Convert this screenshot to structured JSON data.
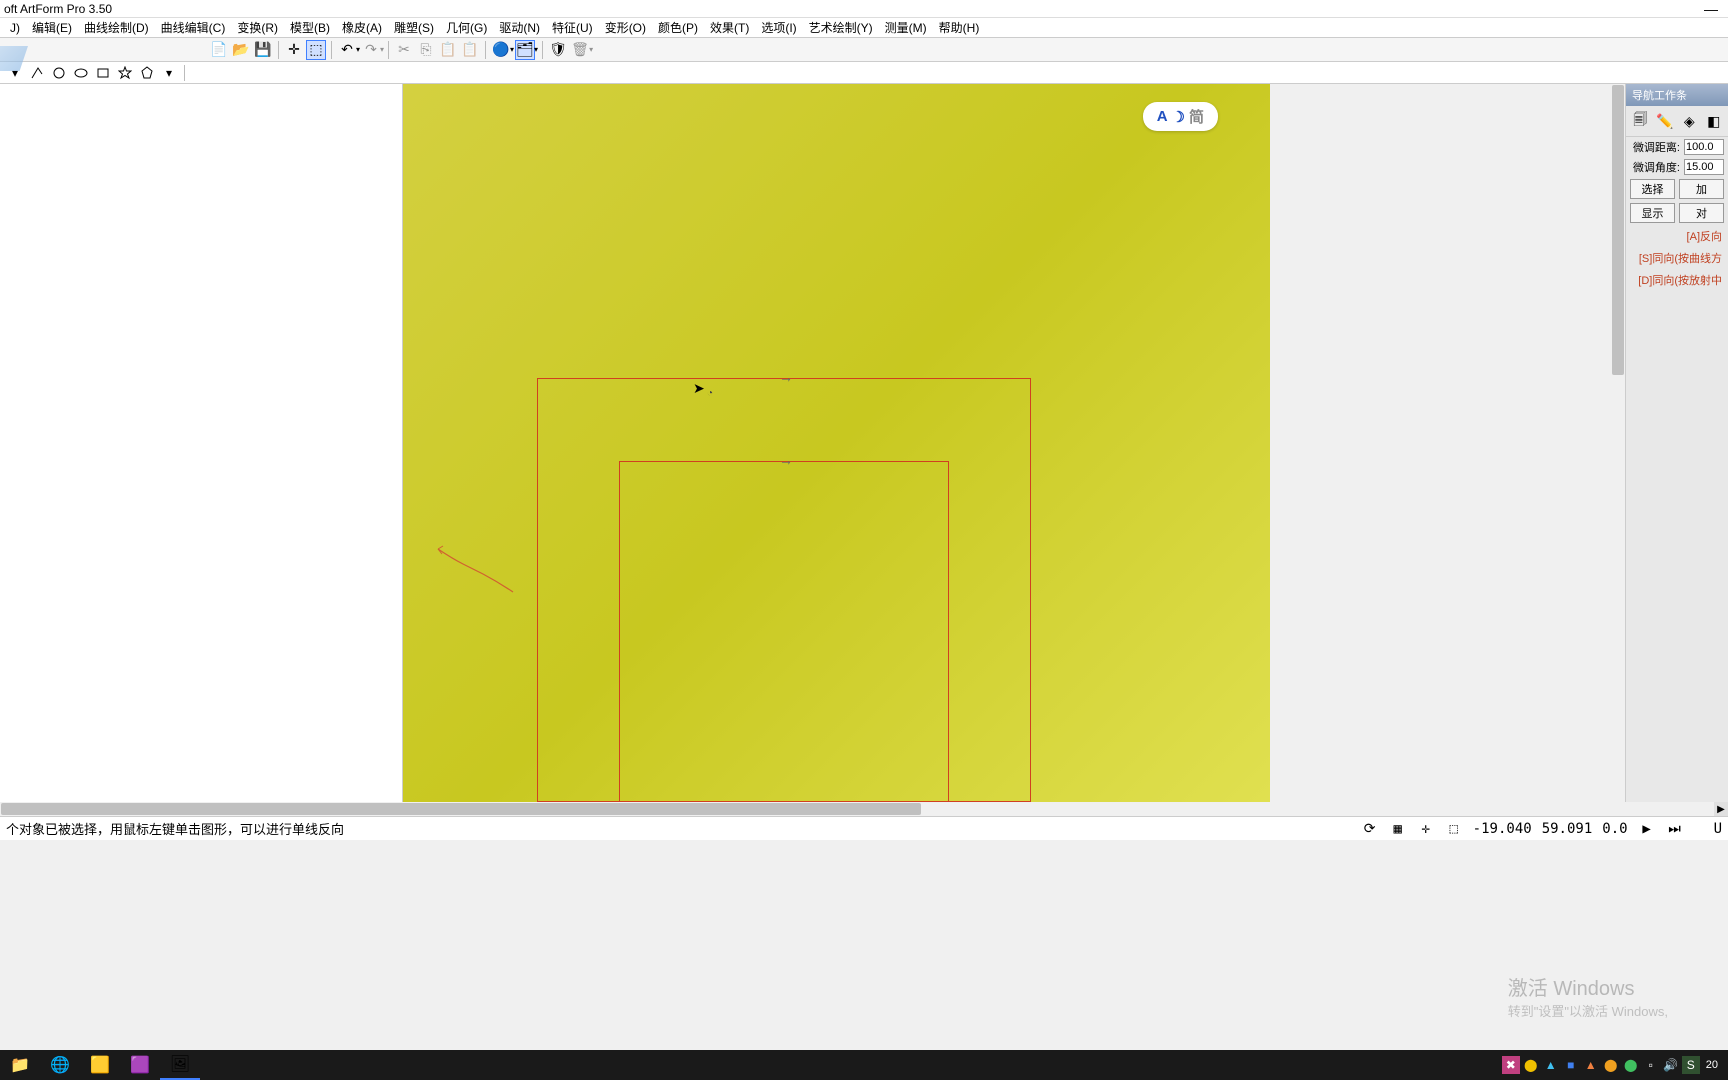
{
  "title": "oft ArtForm Pro 3.50",
  "menu": [
    "J)",
    "编辑(E)",
    "曲线绘制(D)",
    "曲线编辑(C)",
    "变换(R)",
    "模型(B)",
    "橡皮(A)",
    "雕塑(S)",
    "几何(G)",
    "驱动(N)",
    "特征(U)",
    "变形(O)",
    "颜色(P)",
    "效果(T)",
    "选项(I)",
    "艺术绘制(Y)",
    "测量(M)",
    "帮助(H)"
  ],
  "panel": {
    "title": "导航工作条",
    "dist_label": "微调距离:",
    "dist_val": "100.0",
    "angle_label": "微调角度:",
    "angle_val": "15.00",
    "btn_select": "选择",
    "btn_add": "加",
    "btn_show": "显示",
    "btn_pair": "对",
    "link1": "[A]反向",
    "link2": "[S]同向(按曲线方",
    "link3": "[D]同向(按放射中"
  },
  "badge": {
    "a": "A",
    "moon": "☽",
    "jian": "简"
  },
  "status": {
    "msg": "个对象已被选择，用鼠标左键单击图形，可以进行单线反向",
    "x": "-19.040",
    "y": "59.091",
    "z": "0.0"
  },
  "watermark": {
    "line1": "激活 Windows",
    "line2": "转到\"设置\"以激活 Windows,"
  },
  "clock": "20"
}
